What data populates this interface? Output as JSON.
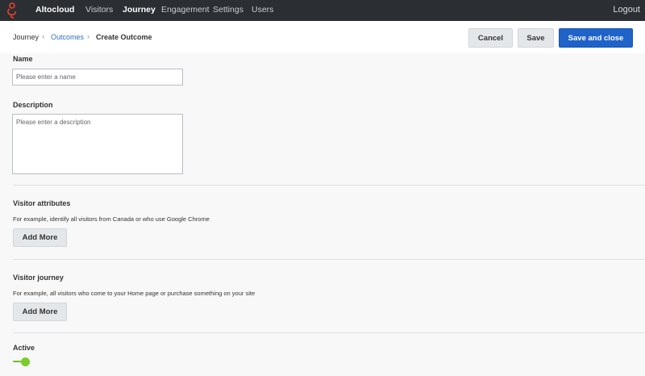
{
  "nav": {
    "brand": "Altocloud",
    "items": [
      {
        "label": "Visitors",
        "active": false
      },
      {
        "label": "Journey",
        "active": true
      },
      {
        "label": "Engagement",
        "active": false
      },
      {
        "label": "Settings",
        "active": false
      },
      {
        "label": "Users",
        "active": false
      }
    ],
    "logout": "Logout"
  },
  "breadcrumb": {
    "items": [
      "Journey",
      "Outcomes",
      "Create Outcome"
    ],
    "separator": "›"
  },
  "actions": {
    "cancel": "Cancel",
    "save": "Save",
    "save_close": "Save and close"
  },
  "form": {
    "name": {
      "label": "Name",
      "placeholder": "Please enter a name"
    },
    "description": {
      "label": "Description",
      "placeholder": "Please enter a description"
    },
    "visitor_attributes": {
      "label": "Visitor attributes",
      "help": "For example, identify all visitors from Canada or who use Google Chrome",
      "button": "Add More"
    },
    "visitor_journey": {
      "label": "Visitor journey",
      "help": "For example, all visitors who come to your Home page or purchase something on your site",
      "button": "Add More"
    },
    "active": {
      "label": "Active",
      "value": true
    }
  },
  "colors": {
    "nav_bg": "#2b2e33",
    "link": "#2e6fc2",
    "primary": "#1f63c9",
    "toggle_on": "#7ccc2a",
    "logo": "#e8412c"
  }
}
